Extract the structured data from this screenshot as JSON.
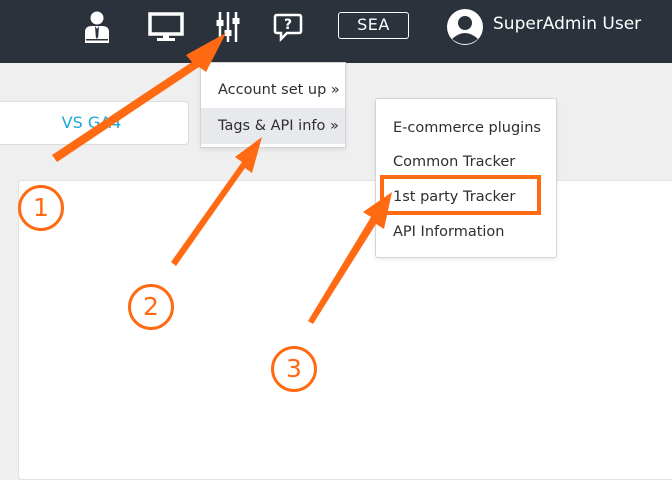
{
  "header": {
    "icons": [
      "admin-user-icon",
      "monitor-icon",
      "settings-sliders-icon",
      "help-chat-icon"
    ],
    "sea_label": "SEA",
    "user_name": "SuperAdmin User"
  },
  "tab": {
    "label": "VS GA4"
  },
  "menu": {
    "items": [
      {
        "label": "Account set up »"
      },
      {
        "label": "Tags & API info »"
      }
    ]
  },
  "submenu": {
    "items": [
      {
        "label": "E-commerce plugins"
      },
      {
        "label": "Common Tracker"
      },
      {
        "label": "1st party Tracker"
      },
      {
        "label": "API Information"
      }
    ]
  },
  "annotations": {
    "steps": [
      "1",
      "2",
      "3"
    ],
    "color": "#ff6a13"
  }
}
